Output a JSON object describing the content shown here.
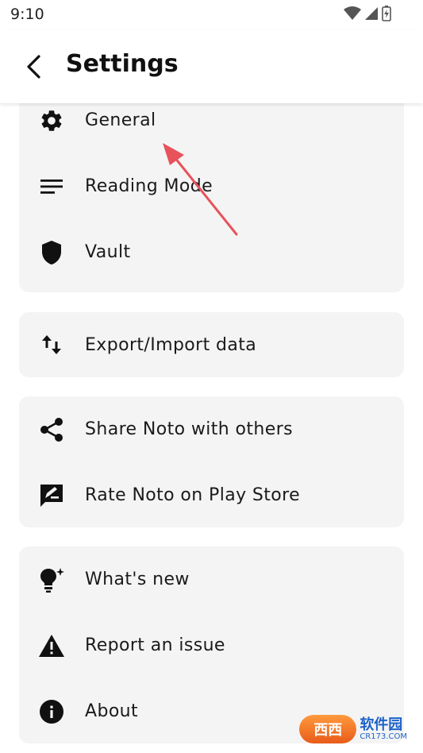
{
  "status_bar": {
    "time": "9:10"
  },
  "app_bar": {
    "title": "Settings"
  },
  "groups": [
    {
      "items": [
        {
          "label": "General",
          "icon": "gear-icon"
        },
        {
          "label": "Reading Mode",
          "icon": "reading-lines-icon"
        },
        {
          "label": "Vault",
          "icon": "shield-icon"
        }
      ]
    },
    {
      "items": [
        {
          "label": "Export/Import data",
          "icon": "swap-vertical-icon"
        }
      ]
    },
    {
      "items": [
        {
          "label": "Share Noto with others",
          "icon": "share-icon"
        },
        {
          "label": "Rate Noto on Play Store",
          "icon": "rate-review-icon"
        }
      ]
    },
    {
      "items": [
        {
          "label": "What's new",
          "icon": "bulb-sparkle-icon"
        },
        {
          "label": "Report an issue",
          "icon": "warning-icon"
        },
        {
          "label": "About",
          "icon": "info-icon"
        }
      ]
    }
  ],
  "watermark": {
    "logo": "西西",
    "main": "软件园",
    "sub": "CR173.COM"
  },
  "colors": {
    "accent": "#e8525b",
    "card_bg": "#f4f4f4"
  }
}
